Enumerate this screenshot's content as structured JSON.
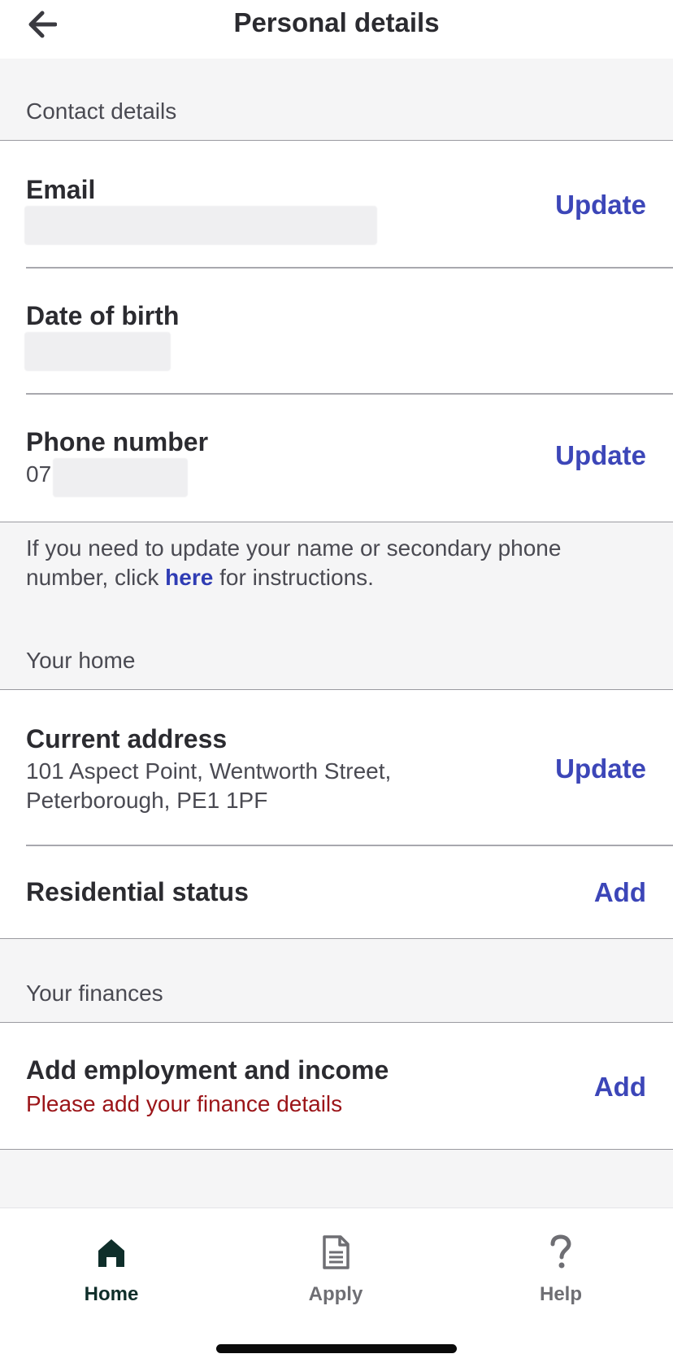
{
  "header": {
    "title": "Personal details",
    "back_icon": "arrow-left-icon"
  },
  "contact": {
    "section_title": "Contact details",
    "email": {
      "label": "Email",
      "action": "Update"
    },
    "dob": {
      "label": "Date of birth"
    },
    "phone": {
      "label": "Phone number",
      "value_prefix": "07",
      "action": "Update"
    }
  },
  "note": {
    "text_before": "If you need to update your name or secondary phone number, click ",
    "link": "here",
    "text_after": " for instructions."
  },
  "home": {
    "section_title": "Your home",
    "address": {
      "label": "Current address",
      "line1": "101 Aspect Point, Wentworth Street,",
      "line2": "Peterborough, PE1 1PF",
      "action": "Update"
    },
    "residential": {
      "label": "Residential status",
      "action": "Add"
    }
  },
  "finances": {
    "section_title": "Your finances",
    "employment": {
      "label": "Add employment and income",
      "error": "Please add your finance details",
      "action": "Add"
    }
  },
  "tabs": [
    {
      "label": "Home",
      "icon": "house-icon",
      "color": "#0f2e2a",
      "active": true
    },
    {
      "label": "Apply",
      "icon": "document-icon",
      "color": "#6e6e73",
      "active": false
    },
    {
      "label": "Help",
      "icon": "question-icon",
      "color": "#6e6e73",
      "active": false
    }
  ],
  "colors": {
    "accent": "#3c46b8",
    "error": "#9b1418",
    "active_tab": "#0f2e2a"
  }
}
